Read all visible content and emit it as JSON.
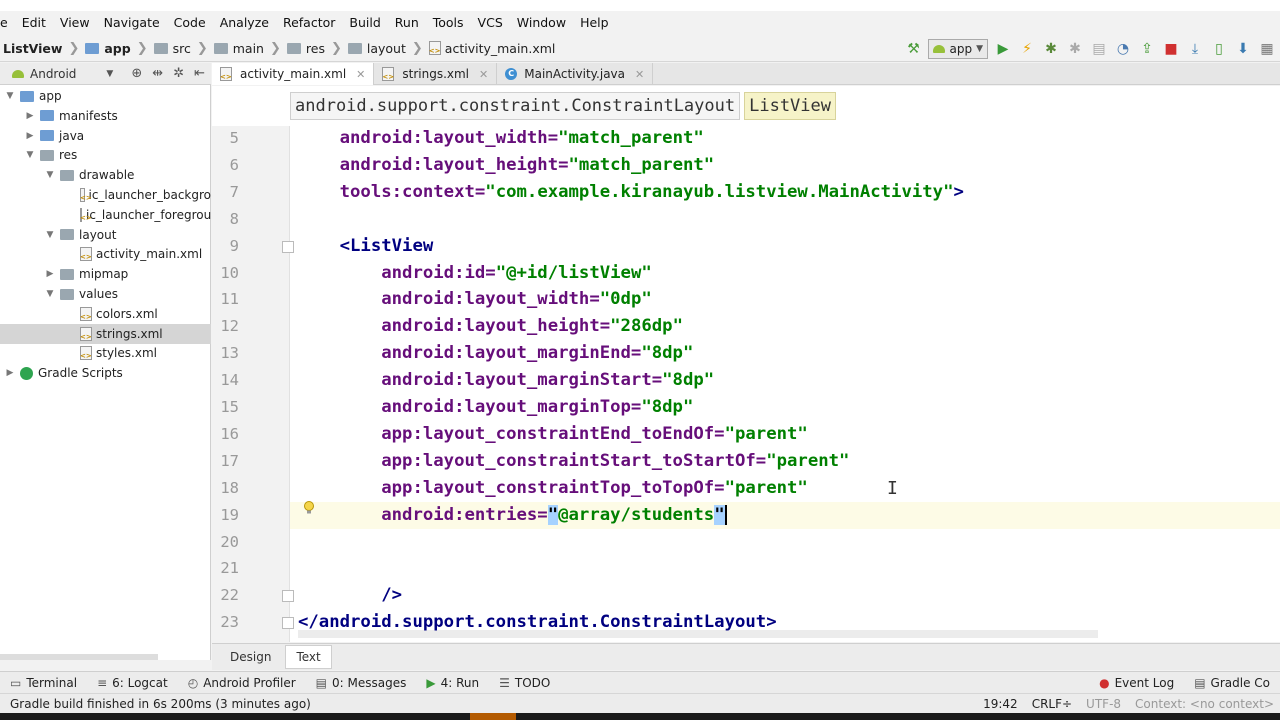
{
  "menubar": {
    "items": [
      "e",
      "Edit",
      "View",
      "Navigate",
      "Code",
      "Analyze",
      "Refactor",
      "Build",
      "Run",
      "Tools",
      "VCS",
      "Window",
      "Help"
    ]
  },
  "navbar": {
    "crumbs": [
      "ListView",
      "app",
      "src",
      "main",
      "res",
      "layout",
      "activity_main.xml"
    ]
  },
  "toolbar": {
    "run_config": "app"
  },
  "project_panel": {
    "view_label": "Android",
    "tree": [
      {
        "label": "app",
        "depth": 0,
        "expanded": true
      },
      {
        "label": "manifests",
        "depth": 1,
        "expanded": false
      },
      {
        "label": "java",
        "depth": 1,
        "expanded": false
      },
      {
        "label": "res",
        "depth": 1,
        "expanded": true
      },
      {
        "label": "drawable",
        "depth": 2,
        "expanded": true
      },
      {
        "label": "ic_launcher_backgro",
        "depth": 3,
        "file": true
      },
      {
        "label": "ic_launcher_foregrou",
        "depth": 3,
        "file": true
      },
      {
        "label": "layout",
        "depth": 2,
        "expanded": true
      },
      {
        "label": "activity_main.xml",
        "depth": 3,
        "file": true
      },
      {
        "label": "mipmap",
        "depth": 2,
        "expanded": false
      },
      {
        "label": "values",
        "depth": 2,
        "expanded": true
      },
      {
        "label": "colors.xml",
        "depth": 3,
        "file": true
      },
      {
        "label": "strings.xml",
        "depth": 3,
        "file": true,
        "selected": true
      },
      {
        "label": "styles.xml",
        "depth": 3,
        "file": true
      },
      {
        "label": "Gradle Scripts",
        "depth": 0,
        "expanded": false,
        "gradle": true
      }
    ]
  },
  "tabs": [
    {
      "label": "activity_main.xml",
      "active": true
    },
    {
      "label": "strings.xml",
      "active": false
    },
    {
      "label": "MainActivity.java",
      "active": false
    }
  ],
  "editor": {
    "breadcrumbs": [
      "android.support.constraint.ConstraintLayout",
      "ListView"
    ],
    "lines": [
      {
        "n": "5",
        "indent": "    ",
        "parts": [
          [
            "attr",
            "android:layout_width="
          ],
          [
            "val",
            "\"match_parent\""
          ]
        ]
      },
      {
        "n": "6",
        "indent": "    ",
        "parts": [
          [
            "attr",
            "android:layout_height="
          ],
          [
            "val",
            "\"match_parent\""
          ]
        ]
      },
      {
        "n": "7",
        "indent": "    ",
        "parts": [
          [
            "attr",
            "tools:context="
          ],
          [
            "val",
            "\"com.example.kiranayub.listview.MainActivity\""
          ],
          [
            "tag",
            ">"
          ]
        ]
      },
      {
        "n": "8",
        "indent": "",
        "parts": []
      },
      {
        "n": "9",
        "indent": "    ",
        "parts": [
          [
            "tag",
            "<ListView"
          ]
        ]
      },
      {
        "n": "10",
        "indent": "        ",
        "parts": [
          [
            "attr",
            "android:id="
          ],
          [
            "val",
            "\"@+id/listView\""
          ]
        ]
      },
      {
        "n": "11",
        "indent": "        ",
        "parts": [
          [
            "attr",
            "android:layout_width="
          ],
          [
            "val",
            "\"0dp\""
          ]
        ]
      },
      {
        "n": "12",
        "indent": "        ",
        "parts": [
          [
            "attr",
            "android:layout_height="
          ],
          [
            "val",
            "\"286dp\""
          ]
        ]
      },
      {
        "n": "13",
        "indent": "        ",
        "parts": [
          [
            "attr",
            "android:layout_marginEnd="
          ],
          [
            "val",
            "\"8dp\""
          ]
        ]
      },
      {
        "n": "14",
        "indent": "        ",
        "parts": [
          [
            "attr",
            "android:layout_marginStart="
          ],
          [
            "val",
            "\"8dp\""
          ]
        ]
      },
      {
        "n": "15",
        "indent": "        ",
        "parts": [
          [
            "attr",
            "android:layout_marginTop="
          ],
          [
            "val",
            "\"8dp\""
          ]
        ]
      },
      {
        "n": "16",
        "indent": "        ",
        "parts": [
          [
            "attr",
            "app:layout_constraintEnd_toEndOf="
          ],
          [
            "val",
            "\"parent\""
          ]
        ]
      },
      {
        "n": "17",
        "indent": "        ",
        "parts": [
          [
            "attr",
            "app:layout_constraintStart_toStartOf="
          ],
          [
            "val",
            "\"parent\""
          ]
        ]
      },
      {
        "n": "18",
        "indent": "        ",
        "parts": [
          [
            "attr",
            "app:layout_constraintTop_toTopOf="
          ],
          [
            "val",
            "\"parent\""
          ]
        ]
      },
      {
        "n": "19",
        "indent": "        ",
        "parts": [
          [
            "attr",
            "android:entries="
          ],
          [
            "selq",
            "\""
          ],
          [
            "val",
            "@array/students"
          ],
          [
            "selq",
            "\""
          ],
          [
            "caret",
            ""
          ]
        ],
        "current": true
      },
      {
        "n": "20",
        "indent": "",
        "parts": []
      },
      {
        "n": "21",
        "indent": "",
        "parts": []
      },
      {
        "n": "22",
        "indent": "        ",
        "parts": [
          [
            "tag",
            "/>"
          ]
        ]
      },
      {
        "n": "23",
        "indent": "",
        "parts": [
          [
            "tag",
            "</android.support.constraint.ConstraintLayout>"
          ]
        ]
      }
    ]
  },
  "design_tabs": [
    {
      "label": "Design",
      "active": false
    },
    {
      "label": "Text",
      "active": true
    }
  ],
  "tool_windows": {
    "left": [
      {
        "icon": "terminal-icon",
        "label": "Terminal"
      },
      {
        "icon": "logcat-icon",
        "label": "6: Logcat"
      },
      {
        "icon": "profiler-icon",
        "label": "Android Profiler"
      },
      {
        "icon": "messages-icon",
        "label": "0: Messages"
      },
      {
        "icon": "run-icon",
        "label": "4: Run"
      },
      {
        "icon": "todo-icon",
        "label": "TODO"
      }
    ],
    "right": [
      {
        "icon": "event-log-icon",
        "label": "Event Log"
      },
      {
        "icon": "gradle-console-icon",
        "label": "Gradle Co"
      }
    ]
  },
  "status": {
    "message": "Gradle build finished in 6s 200ms (3 minutes ago)",
    "position": "19:42",
    "line_sep": "CRLF÷",
    "encoding": "UTF-8",
    "context": "Context: <no context>"
  }
}
